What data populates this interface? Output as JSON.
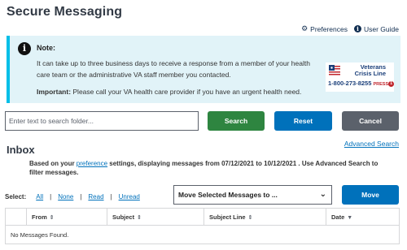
{
  "header": {
    "title": "Secure Messaging"
  },
  "top_links": {
    "preferences": "Preferences",
    "user_guide": "User Guide"
  },
  "alert": {
    "title": "Note:",
    "body": "It can take up to three business days to receive a response from a member of your health care team or the administrative VA staff member you contacted.",
    "important_label": "Important:",
    "important_text": " Please call your VA health care provider if you have an urgent health need."
  },
  "crisis": {
    "name_line1": "Veterans",
    "name_line2": "Crisis Line",
    "phone": "1-800-273-8255",
    "press": "PRESS",
    "press_num": "1"
  },
  "search": {
    "placeholder": "Enter text to search folder...",
    "search_label": "Search",
    "reset_label": "Reset",
    "cancel_label": "Cancel",
    "advanced_label": "Advanced Search"
  },
  "inbox": {
    "title": "Inbox",
    "note_pre": "Based on your ",
    "note_link": "preference",
    "note_post": " settings, displaying messages from 07/12/2021 to 10/12/2021 . Use Advanced Search to filter messages."
  },
  "select": {
    "label": "Select:",
    "all": "All",
    "none": "None",
    "read": "Read",
    "unread": "Unread"
  },
  "move": {
    "select_label": "Move Selected Messages to ...",
    "button_label": "Move"
  },
  "table": {
    "columns": [
      "From",
      "Subject",
      "Subject Line",
      "Date"
    ],
    "empty_text": "No Messages Found."
  },
  "colors": {
    "primary": "#0071bb",
    "success": "#2e8540",
    "secondary": "#5b616b",
    "alert_bg": "#e1f3f8"
  }
}
